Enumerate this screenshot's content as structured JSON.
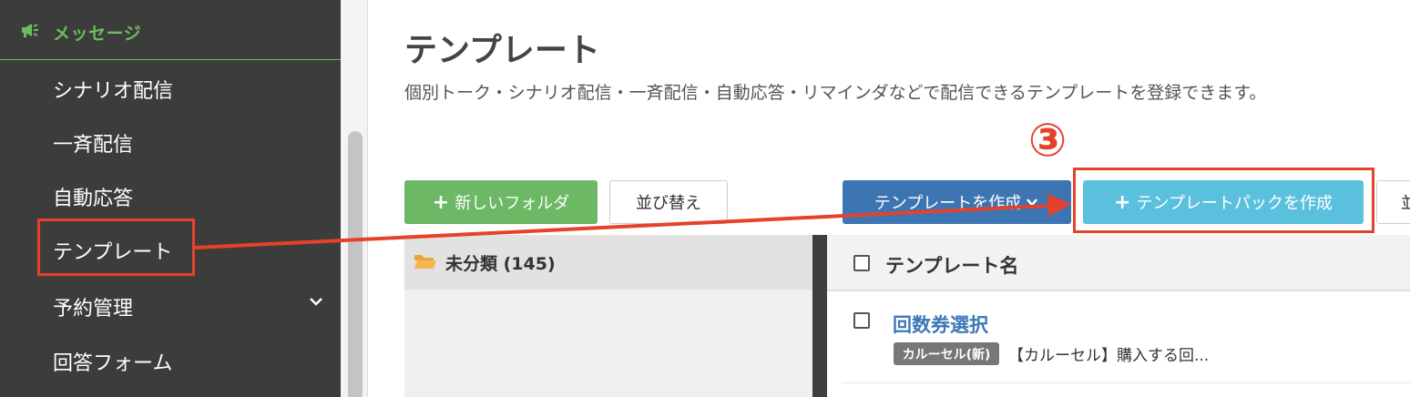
{
  "sidebar": {
    "section_title": "メッセージ",
    "items": [
      {
        "label": "シナリオ配信"
      },
      {
        "label": "一斉配信"
      },
      {
        "label": "自動応答"
      },
      {
        "label": "テンプレート"
      },
      {
        "label": "予約管理"
      },
      {
        "label": "回答フォーム"
      }
    ]
  },
  "main": {
    "title": "テンプレート",
    "description": "個別トーク・シナリオ配信・一斉配信・自動応答・リマインダなどで配信できるテンプレートを登録できます。",
    "buttons": {
      "new_folder": "新しいフォルダ",
      "sort": "並び替え",
      "create_template": "テンプレートを作成",
      "create_pack": "テンプレートパックを作成",
      "cut_sort": "並"
    },
    "folder": {
      "label": "未分類 (145)"
    },
    "table": {
      "header": "テンプレート名",
      "rows": [
        {
          "title": "回数券選択",
          "badge": "カルーセル(新)",
          "desc": "【カルーセル】購入する回..."
        }
      ]
    }
  },
  "annotation": {
    "step_number": "③",
    "color": "#e5422b"
  },
  "colors": {
    "accent_green": "#6bbd5b",
    "blue_button": "#3d75b3",
    "cyan_button": "#5bc0de",
    "sidebar_bg": "#3c3c3c"
  }
}
